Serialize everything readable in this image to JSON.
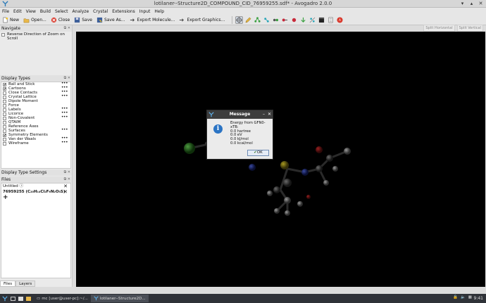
{
  "window": {
    "title": "lotilaner--Structure2D_COMPOUND_CID_76959255.sdf* - Avogadro 2.0.0"
  },
  "menu": [
    {
      "label": "File"
    },
    {
      "label": "Edit"
    },
    {
      "label": "View"
    },
    {
      "label": "Build"
    },
    {
      "label": "Select"
    },
    {
      "label": "Analyze"
    },
    {
      "label": "Crystal"
    },
    {
      "label": "Extensions"
    },
    {
      "label": "Input"
    },
    {
      "label": "Help"
    }
  ],
  "toolbar": {
    "new": "New",
    "open": "Open...",
    "close": "Close",
    "save": "Save",
    "save_as": "Save As...",
    "export_molecule": "Export Molecule...",
    "export_graphics": "Export Graphics..."
  },
  "split": {
    "horizontal": "Split Horizontal",
    "vertical": "Split Vertical"
  },
  "navigate": {
    "title": "Navigate",
    "option": "Reverse Direction of Zoom on Scroll"
  },
  "display_types": {
    "title": "Display Types",
    "items": [
      {
        "label": "Ball and Stick",
        "checked": true,
        "dots": true
      },
      {
        "label": "Cartoons",
        "checked": true,
        "dots": true
      },
      {
        "label": "Close Contacts",
        "checked": false,
        "dots": true
      },
      {
        "label": "Crystal Lattice",
        "checked": false,
        "dots": true
      },
      {
        "label": "Dipole Moment",
        "checked": false,
        "dots": false
      },
      {
        "label": "Force",
        "checked": false,
        "dots": false
      },
      {
        "label": "Labels",
        "checked": false,
        "dots": true
      },
      {
        "label": "Licorice",
        "checked": false,
        "dots": true
      },
      {
        "label": "Non-Covalent",
        "checked": false,
        "dots": true
      },
      {
        "label": "QTAIM",
        "checked": false,
        "dots": false
      },
      {
        "label": "Reference Axes",
        "checked": false,
        "dots": false
      },
      {
        "label": "Surfaces",
        "checked": false,
        "dots": true
      },
      {
        "label": "Symmetry Elements",
        "checked": true,
        "dots": false
      },
      {
        "label": "Van der Waals",
        "checked": false,
        "dots": true
      },
      {
        "label": "Wireframe",
        "checked": false,
        "dots": true
      }
    ]
  },
  "display_settings": {
    "title": "Display Type Settings"
  },
  "files": {
    "title": "Files",
    "items": [
      {
        "label": "Untitled ⓘ"
      },
      {
        "label": "76959255 (C₂₀H₁₄Cl₂F₆N₂O₃S)"
      }
    ],
    "add": "+"
  },
  "bottom_tabs": [
    {
      "label": "Files"
    },
    {
      "label": "Layers"
    }
  ],
  "dialog": {
    "title": "Message",
    "lines": [
      "Energy from GFN0-xTB:",
      "0.0 hartree",
      "0.0 eV",
      "0.0 kJ/mol",
      "0.0 kcal/mol"
    ],
    "ok": "OK"
  },
  "taskbar": {
    "tasks": [
      {
        "label": "mc [user@user-pc]:~/..."
      },
      {
        "label": "lotilaner--Structure2D..."
      }
    ],
    "clock": "9:41"
  }
}
